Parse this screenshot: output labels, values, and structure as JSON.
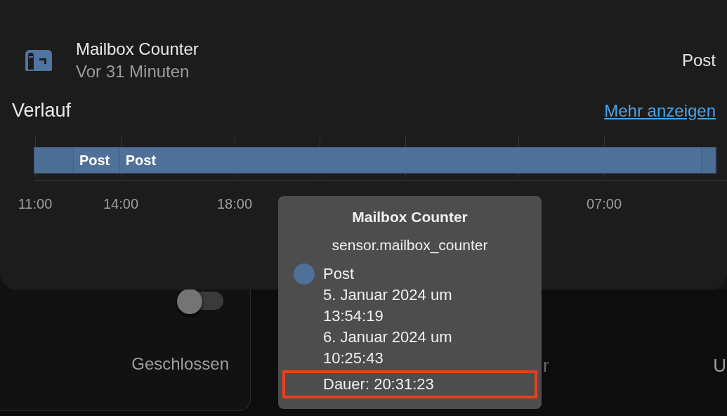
{
  "background": {
    "left_card": {
      "toggle": {
        "on": false
      },
      "state": "Geschlossen"
    },
    "right_card": {
      "partial_text": "r",
      "cut_text": "U"
    }
  },
  "dialog": {
    "entity": {
      "name": "Mailbox Counter",
      "last_changed": "Vor 31 Minuten",
      "state": "Post"
    },
    "history": {
      "title": "Verlauf",
      "more_link": "Mehr anzeigen",
      "segments": [
        {
          "kind": "gap"
        },
        {
          "kind": "state",
          "label": "Post"
        },
        {
          "kind": "state",
          "label": "Post"
        },
        {
          "kind": "gap"
        }
      ],
      "axis": [
        "11:00",
        "14:00",
        "18:00",
        "07:00"
      ]
    }
  },
  "tooltip": {
    "title": "Mailbox Counter",
    "entity_id": "sensor.mailbox_counter",
    "color": "#4f7199",
    "state": "Post",
    "lines": [
      {
        "text": "5. Januar 2024 um 13:54:19",
        "highlighted": false
      },
      {
        "text": "6. Januar 2024 um 10:25:43",
        "highlighted": false
      },
      {
        "text": "Dauer: 20:31:23",
        "highlighted": true
      }
    ]
  }
}
